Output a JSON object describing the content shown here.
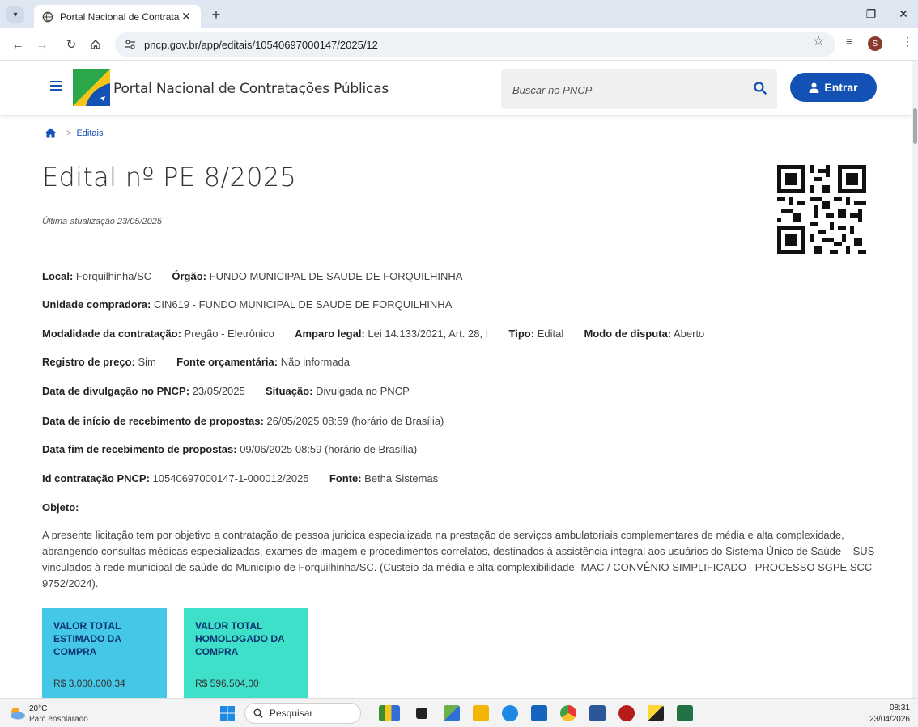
{
  "browser": {
    "tab_title": "Portal Nacional de Contrataçõe",
    "url": "pncp.gov.br/app/editais/10540697000147/2025/12",
    "profile_initial": "S"
  },
  "header": {
    "site_title": "Portal Nacional de Contratações Públicas",
    "search_placeholder": "Buscar no PNCP",
    "login_label": "Entrar"
  },
  "breadcrumb": {
    "current": "Editais"
  },
  "page": {
    "title": "Edital nº PE 8/2025",
    "updated": "Última atualização 23/05/2025"
  },
  "details": {
    "local_label": "Local:",
    "local_value": "Forquilhinha/SC",
    "orgao_label": "Órgão:",
    "orgao_value": "FUNDO MUNICIPAL DE SAUDE DE FORQUILHINHA",
    "unidade_label": "Unidade compradora:",
    "unidade_value": "CIN619 - FUNDO MUNICIPAL DE SAUDE DE FORQUILHINHA",
    "modalidade_label": "Modalidade da contratação:",
    "modalidade_value": "Pregão - Eletrônico",
    "amparo_label": "Amparo legal:",
    "amparo_value": "Lei 14.133/2021, Art. 28, I",
    "tipo_label": "Tipo:",
    "tipo_value": "Edital",
    "modo_label": "Modo de disputa:",
    "modo_value": "Aberto",
    "registro_label": "Registro de preço:",
    "registro_value": "Sim",
    "fonte_orc_label": "Fonte orçamentária:",
    "fonte_orc_value": "Não informada",
    "divulgacao_label": "Data de divulgação no PNCP:",
    "divulgacao_value": "23/05/2025",
    "situacao_label": "Situação:",
    "situacao_value": "Divulgada no PNCP",
    "inicio_label": "Data de início de recebimento de propostas:",
    "inicio_value": "26/05/2025 08:59 (horário de Brasília)",
    "fim_label": "Data fim de recebimento de propostas:",
    "fim_value": "09/06/2025 08:59 (horário de Brasília)",
    "id_label": "Id contratação PNCP:",
    "id_value": "10540697000147-1-000012/2025",
    "fonte_label": "Fonte:",
    "fonte_value": "Betha Sistemas",
    "objeto_label": "Objeto:",
    "objeto_text": "A presente licitação tem por objetivo a contratação de pessoa juridica especializada na prestação de serviços ambulatoriais complementares de média e alta complexidade, abrangendo consultas médicas especializadas, exames de imagem e procedimentos correlatos, destinados à assistência integral aos usuários do Sistema Único de Saúde – SUS vinculados à rede municipal de saúde do Município de Forquilhinha/SC. (Custeio da média e alta complexibilidade -MAC / CONVÊNIO SIMPLIFICADO– PROCESSO SGPE SCC 9752/2024)."
  },
  "cards": [
    {
      "title": "VALOR TOTAL ESTIMADO DA COMPRA",
      "value": "R$ 3.000.000,34",
      "color": "#45c8e8"
    },
    {
      "title": "VALOR TOTAL HOMOLOGADO DA COMPRA",
      "value": "R$ 596.504,00",
      "color": "#3fe0c9"
    }
  ],
  "taskbar": {
    "temperature": "20°C",
    "weather": "Parc ensolarado",
    "search_label": "Pesquisar",
    "time": "08:31",
    "date": "23/04/2026"
  },
  "colors": {
    "primary": "#1351b4",
    "card_title": "#0c326f"
  }
}
